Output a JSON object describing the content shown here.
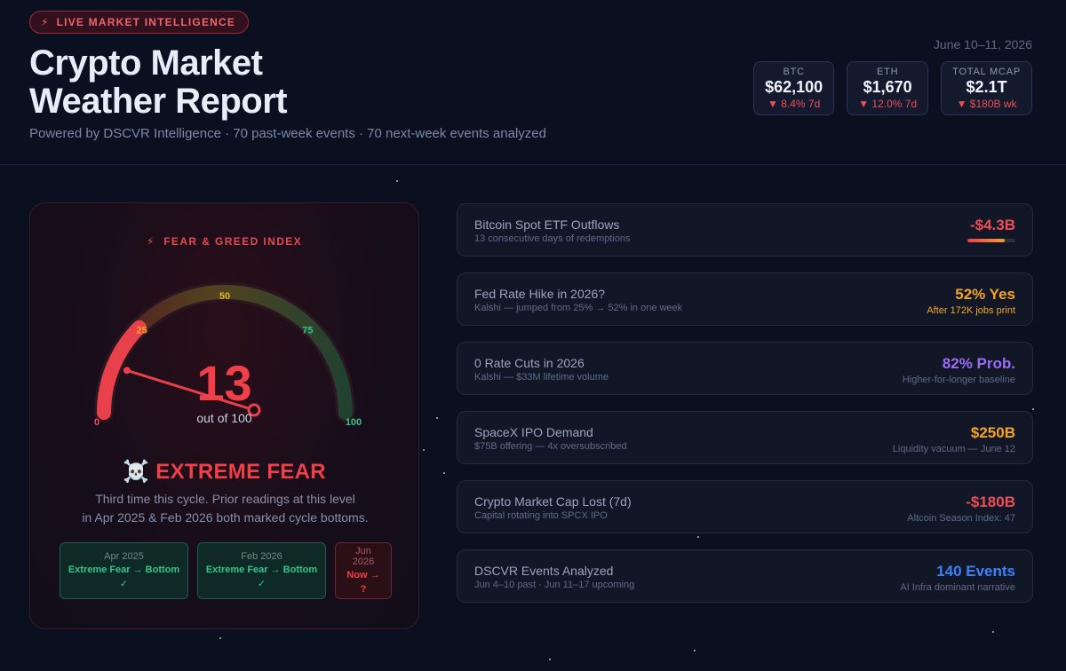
{
  "colors": {
    "background": "#0b1020",
    "fear_red": "#ef3f49",
    "orange": "#f5a524",
    "purple": "#9b6cf5",
    "blue": "#3b82f6",
    "green": "#34c58c"
  },
  "header": {
    "badge_icon": "lightning-icon",
    "badge": "LIVE MARKET INTELLIGENCE",
    "title_line1": "Crypto Market",
    "title_line2": "Weather Report",
    "subtitle": "Powered by DSCVR Intelligence · 70 past-week events · 70 next-week events analyzed",
    "date": "June 10–11, 2026",
    "tickers": [
      {
        "label": "BTC",
        "value": "$62,100",
        "change": "▼ 8.4% 7d"
      },
      {
        "label": "ETH",
        "value": "$1,670",
        "change": "▼ 12.0% 7d"
      },
      {
        "label": "TOTAL MCAP",
        "value": "$2.1T",
        "change": "▼ $180B wk"
      }
    ]
  },
  "gauge": {
    "label_icon": "lightning-icon",
    "label": "FEAR & GREED INDEX",
    "value": 13,
    "value_text": "13",
    "min": 0,
    "max": 100,
    "out_of": "out of 100",
    "ticks": [
      {
        "value": 0,
        "label": "0",
        "color": "#ef4d55"
      },
      {
        "value": 25,
        "label": "25",
        "color": "#f5a524"
      },
      {
        "value": 50,
        "label": "50",
        "color": "#e0b422"
      },
      {
        "value": 75,
        "label": "75",
        "color": "#34c58c"
      },
      {
        "value": 100,
        "label": "100",
        "color": "#34c58c"
      }
    ],
    "sentiment_icon": "skull-crossbones-icon",
    "sentiment": "☠️ EXTREME FEAR",
    "description_line1": "Third time this cycle. Prior readings at this level",
    "description_line2": "in Apr 2025 & Feb 2026 both marked cycle bottoms.",
    "history": [
      {
        "date": "Apr 2025",
        "text": "Extreme Fear → Bottom",
        "mark": "✓",
        "tone": "green"
      },
      {
        "date": "Feb 2026",
        "text": "Extreme Fear → Bottom",
        "mark": "✓",
        "tone": "green"
      },
      {
        "date_line1": "Jun",
        "date_line2": "2026",
        "text": "Now →",
        "mark": "?",
        "tone": "red"
      }
    ]
  },
  "metrics": [
    {
      "title": "Bitcoin Spot ETF Outflows",
      "sub": "13 consecutive days of redemptions",
      "value": "-$4.3B",
      "value_color": "#ef4d55",
      "note": "",
      "bar_fraction": 0.78
    },
    {
      "title": "Fed Rate Hike in 2026?",
      "sub": "Kalshi — jumped from 25% → 52% in one week",
      "value": "52% Yes",
      "value_color": "#f5a524",
      "note": "After 172K jobs print",
      "note_color": "#f5a524"
    },
    {
      "title": "0 Rate Cuts in 2026",
      "sub": "Kalshi — $33M lifetime volume",
      "value": "82% Prob.",
      "value_color": "#9b6cf5",
      "note": "Higher-for-longer baseline"
    },
    {
      "title": "SpaceX IPO Demand",
      "sub": "$75B offering — 4x oversubscribed",
      "value": "$250B",
      "value_color": "#f5a524",
      "note": "Liquidity vacuum — June 12"
    },
    {
      "title": "Crypto Market Cap Lost (7d)",
      "sub": "Capital rotating into SPCX IPO",
      "value": "-$180B",
      "value_color": "#ef4d55",
      "note": "Altcoin Season Index: 47"
    },
    {
      "title": "DSCVR Events Analyzed",
      "sub": "Jun 4–10 past · Jun 11–17 upcoming",
      "value": "140 Events",
      "value_color": "#3b82f6",
      "note": "AI Infra dominant narrative"
    }
  ]
}
